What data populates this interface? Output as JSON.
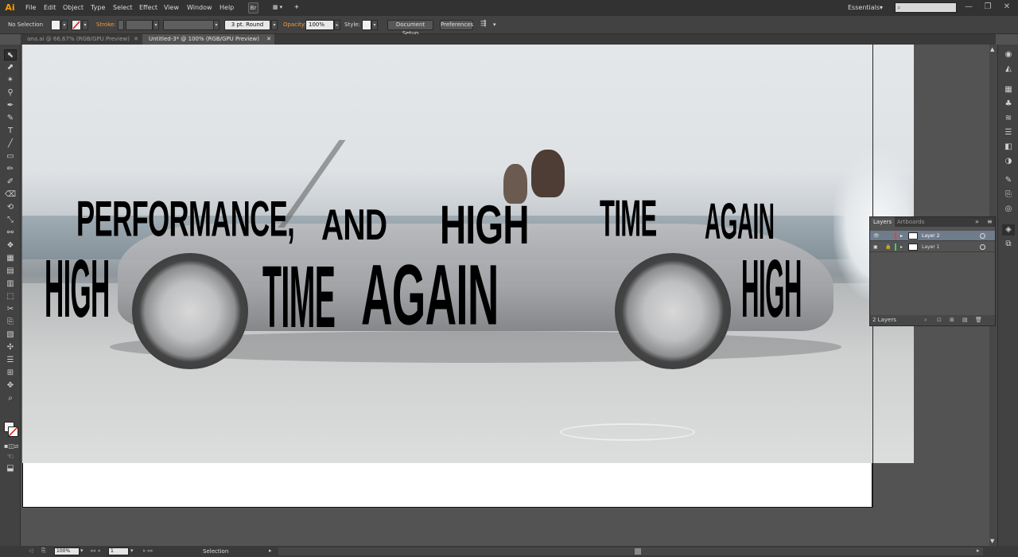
{
  "app": {
    "logo": "Ai"
  },
  "menu": [
    "File",
    "Edit",
    "Object",
    "Type",
    "Select",
    "Effect",
    "View",
    "Window",
    "Help"
  ],
  "menubar_buttons": {
    "bridge": "Br",
    "arrange": "▦ ▾",
    "gpu": "✈"
  },
  "workspace": {
    "label": "Essentials",
    "arrow": "▾"
  },
  "search": {
    "placeholder": ""
  },
  "window_controls": {
    "minimize": "—",
    "restore": "❐",
    "close": "✕"
  },
  "control_bar": {
    "selection": "No Selection",
    "stroke_label": "Stroke:",
    "stroke_weight": "",
    "brush": "3 pt. Round",
    "opacity_label": "Opacity:",
    "opacity_value": "100%",
    "style_label": "Style:",
    "document_setup": "Document Setup",
    "preferences": "Preferences"
  },
  "tabs": [
    {
      "label": "ana.ai @ 66,67% (RGB/GPU Preview)",
      "close": "✕"
    },
    {
      "label": "Untitled-3* @ 100% (RGB/GPU Preview)",
      "close": "✕"
    }
  ],
  "tools": [
    "⬉",
    "⬈",
    "✴",
    "⚲",
    "✒",
    "✎",
    "T",
    "╱",
    "▭",
    "✏",
    "✐",
    "⌫",
    "⟲",
    "⤡",
    "⚯",
    "❖",
    "▦",
    "▤",
    "▥",
    "⬚",
    "✂",
    "⎘",
    "▧",
    "✣",
    "☰",
    "⊞",
    "✥",
    "⌕",
    "☜",
    "⬓"
  ],
  "artwork_text": {
    "performance": "PERFORMANCE,",
    "and": "AND",
    "high_top": "HIGH",
    "time_top": "TIME",
    "again_top": "AGAIN",
    "high_left": "HIGH",
    "time_mid": "TIME",
    "again_mid": "AGAIN",
    "high_right": "HIGH"
  },
  "layers_panel": {
    "tabs": [
      "Layers",
      "Artboards"
    ],
    "menu": "≡",
    "collapse": "»",
    "layers": [
      {
        "name": "Layer 2",
        "color": "#ff3b3b",
        "selected": true
      },
      {
        "name": "Layer 1",
        "color": "#3bd35a",
        "selected": false
      }
    ],
    "count": "2 Layers"
  },
  "status_bar": {
    "zoom": "100%",
    "artboard": "1",
    "tool": "Selection"
  },
  "colors": {
    "menubar": "#323232",
    "panel": "#424242",
    "canvas": "#535353",
    "accent": "#f29a38"
  }
}
